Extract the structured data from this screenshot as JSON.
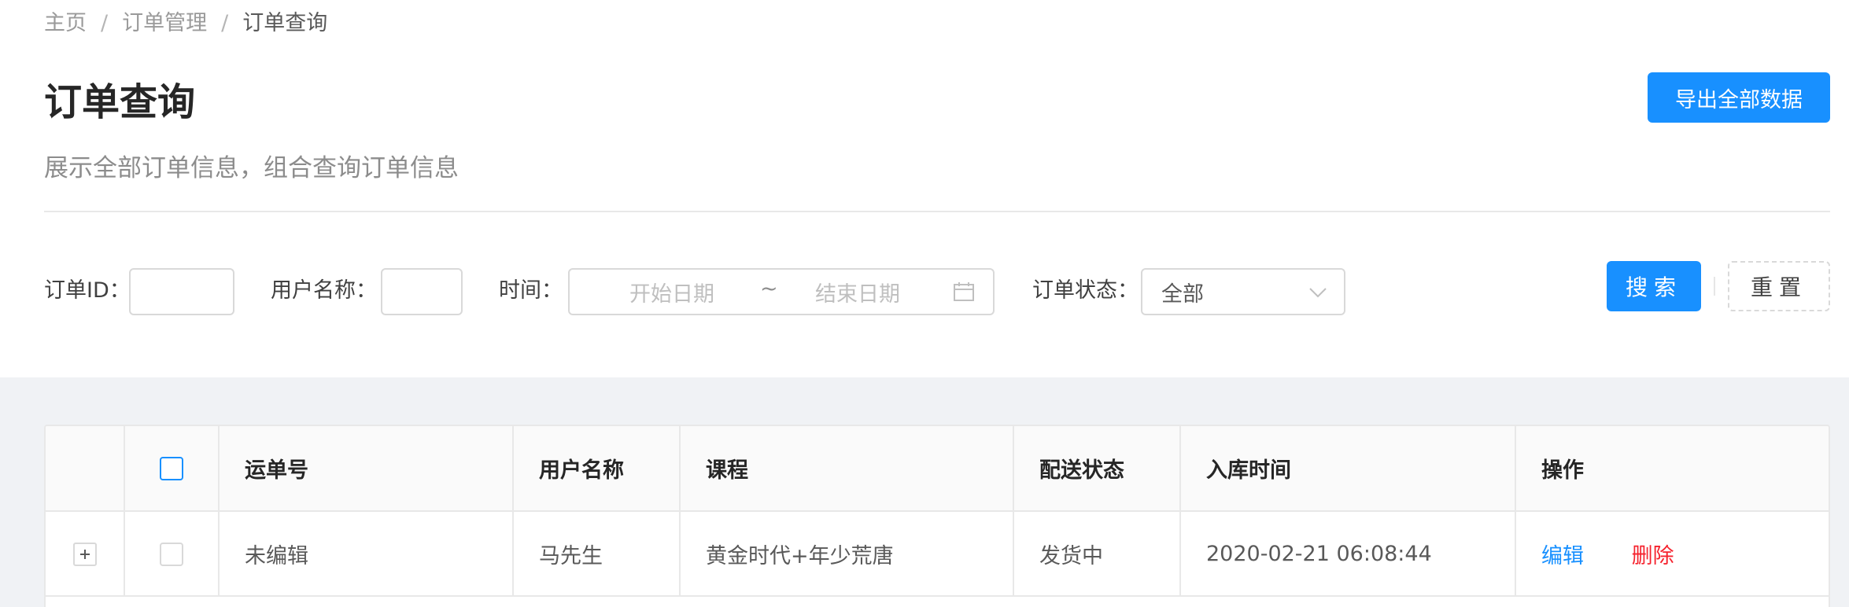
{
  "breadcrumb": {
    "items": [
      "主页",
      "订单管理",
      "订单查询"
    ],
    "separator": "/"
  },
  "header": {
    "title": "订单查询",
    "subtitle": "展示全部订单信息，组合查询订单信息",
    "export_label": "导出全部数据"
  },
  "filters": {
    "order_id_label": "订单ID：",
    "order_id_value": "",
    "username_label": "用户名称：",
    "username_value": "",
    "time_label": "时间：",
    "start_placeholder": "开始日期",
    "range_separator": "~",
    "end_placeholder": "结束日期",
    "status_label": "订单状态：",
    "status_value": "全部",
    "search_label": "搜索",
    "reset_label": "重置"
  },
  "table": {
    "columns": [
      "运单号",
      "用户名称",
      "课程",
      "配送状态",
      "入库时间",
      "操作"
    ],
    "rows": [
      {
        "waybill": "未编辑",
        "username": "马先生",
        "course": "黄金时代+年少荒唐",
        "delivery_status": "发货中",
        "storage_time": "2020-02-21 06:08:44",
        "actions": {
          "edit": "编辑",
          "delete": "删除"
        }
      }
    ]
  },
  "colors": {
    "primary": "#1890ff",
    "danger": "#f5222d",
    "background": "#f0f2f5"
  },
  "icons": {
    "calendar": "calendar-icon",
    "dropdown": "chevron-down-icon",
    "expand": "plus-square-icon"
  }
}
